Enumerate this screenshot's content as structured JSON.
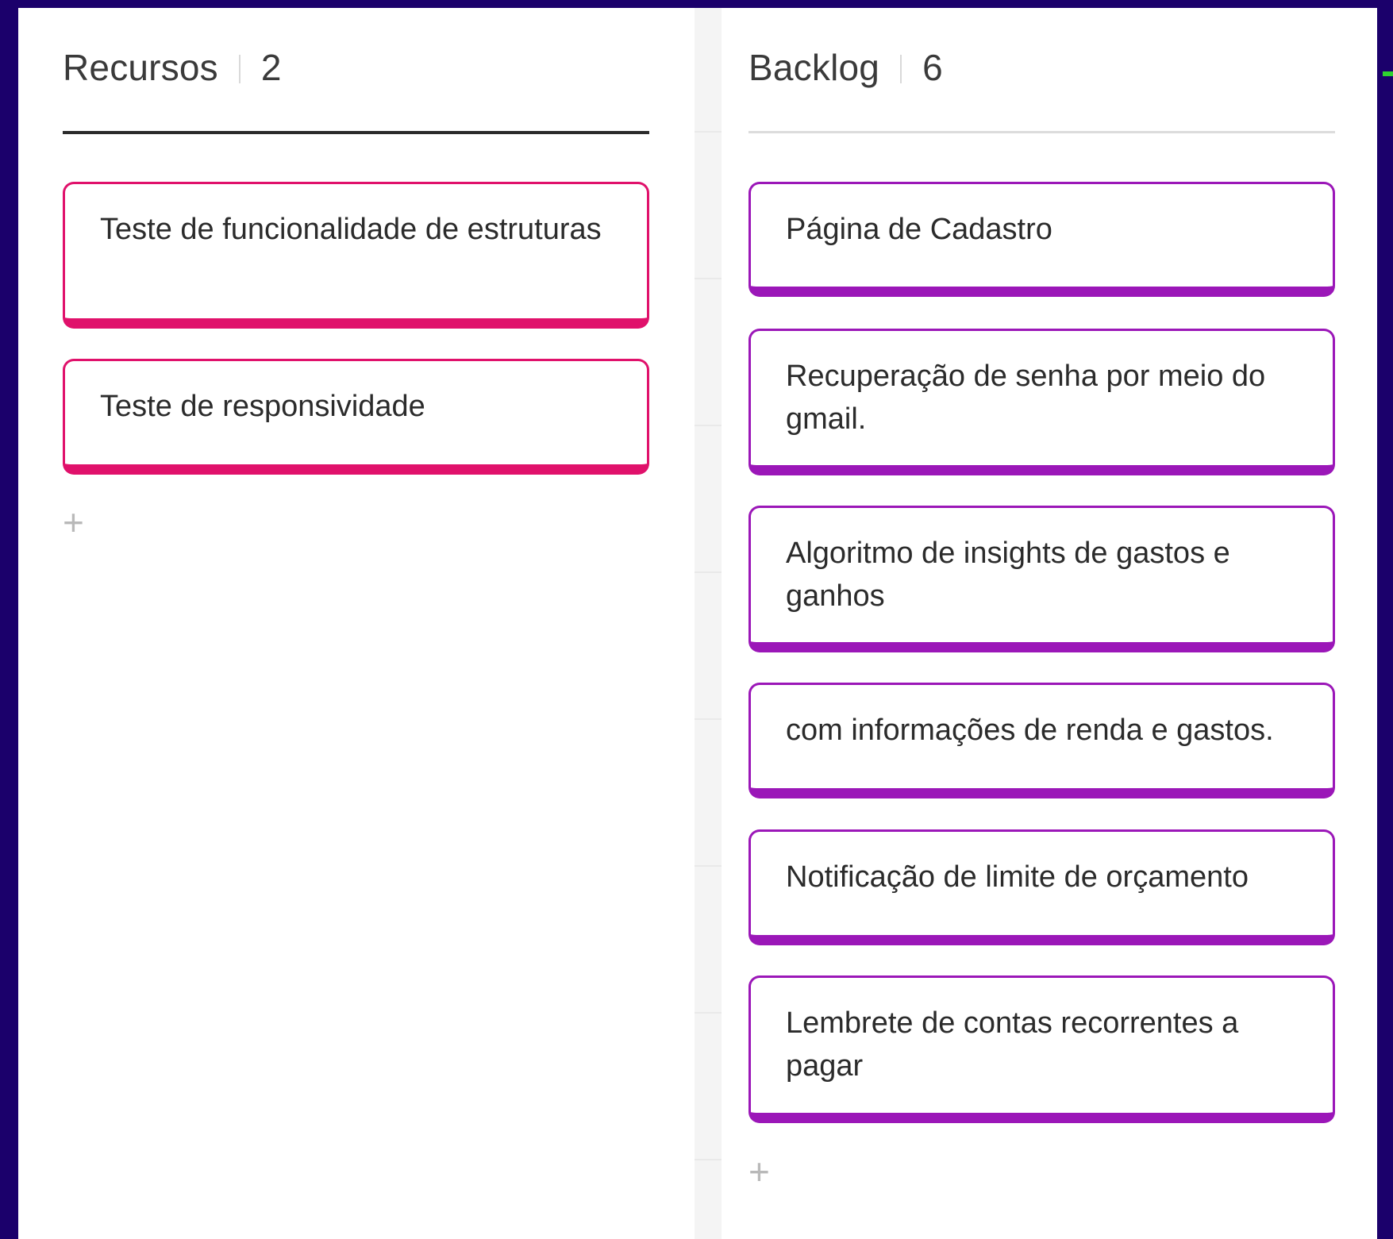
{
  "columns": [
    {
      "title": "Recursos",
      "count": "2",
      "accent": "#e0116b",
      "cards": [
        {
          "text": "Teste de funcionalidade de estruturas"
        },
        {
          "text": "Teste de responsividade"
        }
      ],
      "add_icon": "plus-icon",
      "add_symbol": "+"
    },
    {
      "title": "Backlog",
      "count": "6",
      "accent": "#9b17b8",
      "cards": [
        {
          "text": "Página de Cadastro"
        },
        {
          "text": "Recuperação de senha por meio do gmail."
        },
        {
          "text": "Algoritmo de insights de gastos e ganhos"
        },
        {
          "text": "com informações de renda e gastos."
        },
        {
          "text": "Notificação de limite de orçamento"
        },
        {
          "text": "Lembrete de contas recorrentes a pagar"
        }
      ],
      "add_icon": "plus-icon",
      "add_symbol": "+"
    }
  ],
  "colors": {
    "background": "#1b006b",
    "board": "#ffffff",
    "resources_accent": "#e0116b",
    "backlog_accent": "#9b17b8"
  }
}
